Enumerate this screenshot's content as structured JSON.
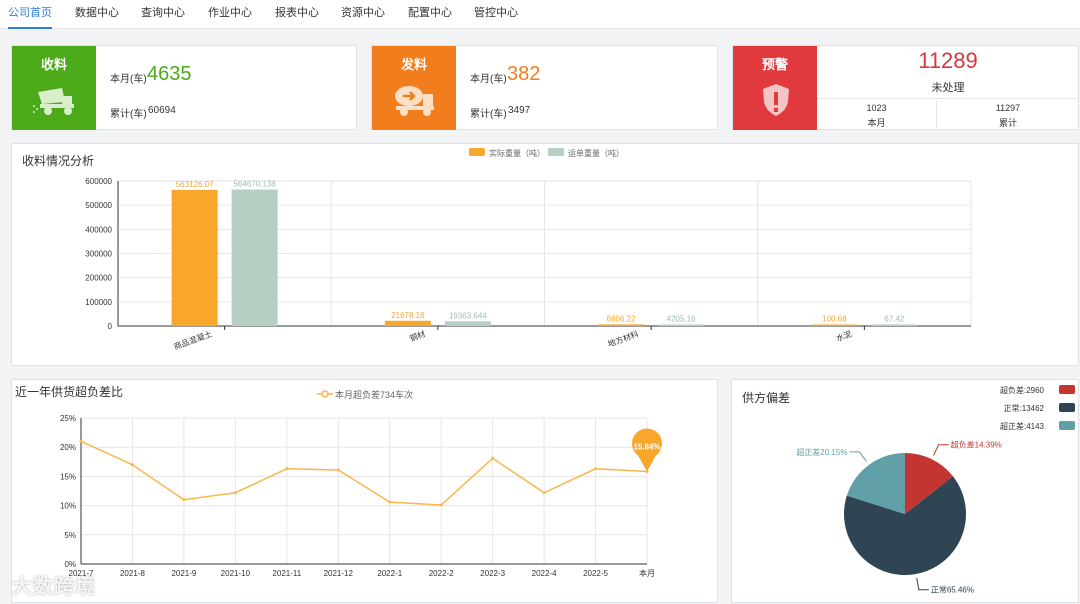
{
  "nav": {
    "tabs": [
      "公司首页",
      "数据中心",
      "查询中心",
      "作业中心",
      "报表中心",
      "资源中心",
      "配置中心",
      "管控中心"
    ],
    "active_index": 0
  },
  "kpi": {
    "receive": {
      "title": "收料",
      "color": "#4caa1a",
      "icon": "dump-truck-icon",
      "month_label": "本月(车)",
      "month_value": "4635",
      "total_label": "累计(车)",
      "total_value": "60694"
    },
    "dispatch": {
      "title": "发料",
      "color": "#f27d1c",
      "icon": "mixer-truck-icon",
      "month_label": "本月(车)",
      "month_value": "382",
      "total_label": "累计(车)",
      "total_value": "3497"
    },
    "alert": {
      "title": "预警",
      "color": "#e0393e",
      "icon": "shield-icon",
      "value": "11289",
      "value_label": "未处理",
      "month_value": "1023",
      "month_label": "本月",
      "total_value": "11297",
      "total_label": "累计"
    }
  },
  "receive_analysis": {
    "title": "收料情况分析",
    "legend": [
      {
        "name": "实际重量（吨）",
        "color": "#f9a72c"
      },
      {
        "name": "运单重量（吨）",
        "color": "#b6cfc2"
      }
    ]
  },
  "over_under": {
    "title": "近一年供货超负差比",
    "legend": "本月超负差734车次",
    "line_color": "#f9b748",
    "marker_label": "15.84%"
  },
  "supplier_dev": {
    "title": "供方偏差",
    "legend": [
      {
        "name": "超负差:2960",
        "color": "#c23531"
      },
      {
        "name": "正常:13462",
        "color": "#2f4554"
      },
      {
        "name": "超正差:4143",
        "color": "#61a0a8"
      }
    ],
    "slice_labels": [
      "超负差14.39%",
      "正常65.46%",
      "超正差20.15%"
    ]
  },
  "watermark": "大数跨境",
  "chart_data": [
    {
      "type": "bar",
      "title": "收料情况分析",
      "categories": [
        "商品混凝土",
        "钢材",
        "地方材料",
        "水泥"
      ],
      "series": [
        {
          "name": "实际重量（吨）",
          "values": [
            563126.07,
            21678.16,
            6806.22,
            100.68
          ],
          "labels": [
            "563126.07",
            "21678.16",
            "6806.22",
            "100.68"
          ]
        },
        {
          "name": "运单重量（吨）",
          "values": [
            564670.138,
            19363.644,
            4205.16,
            67.42
          ],
          "labels": [
            "564670.138",
            "19363.644",
            "4205.16",
            "67.42"
          ]
        }
      ],
      "ylim": [
        0,
        600000
      ],
      "yticks": [
        0,
        100000,
        200000,
        300000,
        400000,
        500000,
        600000
      ],
      "grid": true,
      "legend_position": "top-center"
    },
    {
      "type": "line",
      "title": "近一年供货超负差比",
      "x": [
        "2021-7",
        "2021-8",
        "2021-9",
        "2021-10",
        "2021-11",
        "2021-12",
        "2022-1",
        "2022-2",
        "2022-3",
        "2022-4",
        "2022-5",
        "本月"
      ],
      "series": [
        {
          "name": "本月超负差734车次",
          "values": [
            21,
            17,
            11,
            12.2,
            16.3,
            16.1,
            10.6,
            10.1,
            18.1,
            12.2,
            16.3,
            15.84
          ]
        }
      ],
      "ylim": [
        0,
        25
      ],
      "yticks": [
        "0%",
        "5%",
        "10%",
        "15%",
        "20%",
        "25%"
      ],
      "grid": true,
      "legend_position": "top-center",
      "annotation": "15.84%"
    },
    {
      "type": "pie",
      "title": "供方偏差",
      "slices": [
        {
          "name": "超负差",
          "value": 2960,
          "percent": 14.39
        },
        {
          "name": "正常",
          "value": 13462,
          "percent": 65.46
        },
        {
          "name": "超正差",
          "value": 4143,
          "percent": 20.15
        }
      ],
      "legend_position": "top-right"
    }
  ]
}
